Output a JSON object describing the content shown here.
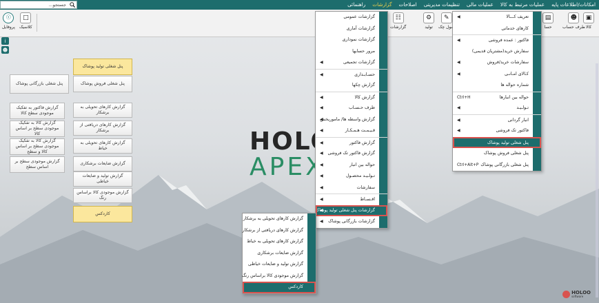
{
  "topbar": {
    "menu": [
      "امکانات/اطلاعات پایه",
      "عملیات مرتبط به کالا",
      "عملیات مالی",
      "تنظیمات مدیریتی",
      "اصلاحات",
      "گزارشات",
      "راهنمائی"
    ],
    "active_index": 5,
    "search_placeholder": "جستجو..."
  },
  "toolbar": {
    "left": [
      {
        "label": "پروفایل",
        "icon": "lamp-icon"
      },
      {
        "label": "کلاسیک",
        "icon": "classic-icon"
      }
    ],
    "right": [
      {
        "label": "کالا",
        "icon": "box-icon"
      },
      {
        "label": "طرف حساب",
        "icon": "account-icon"
      },
      {
        "label": "حسا",
        "icon": "ledger-icon"
      },
      {
        "label": "سول چک",
        "icon": "check-icon"
      },
      {
        "label": "تولید",
        "icon": "production-icon"
      },
      {
        "label": "گزارشات",
        "icon": "reports-icon"
      }
    ]
  },
  "panel": {
    "col_left": [
      "پنل شغلی بازرگانی پوشاک",
      "گزارش فاکتور به تفکیک موجودی سطح کالا",
      "گزارش کالا به تفکیک موجودی سطح بر اساس کالا",
      "گزارش کالا به تفکیک موجودی سطح بر اساس کالا و سطح",
      "گزارش موجودی سطح بر اساس سطح"
    ],
    "col_right": [
      "پنل شغلی تولید پوشاک",
      "پنل شغلی فروش پوشاک",
      "گزارش کارهای تحویلی به برشکار",
      "گزارش کارهای دریافتی از برشکار",
      "گزارش کارهای تحویلی به خیاط",
      "گزارش ضایعات برشکاری",
      "گزارش تولید و ضایعات خیاطی",
      "گزارش موجودی کالا براساس رنگ",
      "کاردکس"
    ]
  },
  "logo": {
    "line1": "HOLOO",
    "line2": "APEX"
  },
  "menu_kala": {
    "items": [
      {
        "label": "تعریف کـــالا",
        "arrow": true,
        "sep": false,
        "shortcut": ""
      },
      {
        "label": "کارهای خدماتی",
        "arrow": false,
        "sep": false,
        "shortcut": ""
      },
      {
        "label": "فاکتور : عمده فروشی",
        "arrow": true,
        "sep": true,
        "shortcut": ""
      },
      {
        "label": "سفارش خرید(مشتریان قدیمی)",
        "arrow": false,
        "sep": false,
        "shortcut": ""
      },
      {
        "label": "سفارشات خرید/فروش",
        "arrow": true,
        "sep": false,
        "shortcut": ""
      },
      {
        "label": "کـالای امـانـی",
        "arrow": true,
        "sep": false,
        "shortcut": ""
      },
      {
        "label": "شماره حواله ها",
        "arrow": false,
        "sep": false,
        "shortcut": ""
      },
      {
        "label": "حواله بین انبارها",
        "arrow": false,
        "sep": true,
        "shortcut": "Ctrl+H"
      },
      {
        "label": "تـولـیـد",
        "arrow": true,
        "sep": false,
        "shortcut": ""
      },
      {
        "label": "انبار گردانی",
        "arrow": true,
        "sep": true,
        "shortcut": ""
      },
      {
        "label": "فاکتور تک فروشی",
        "arrow": true,
        "sep": false,
        "shortcut": ""
      },
      {
        "label": "پنل شغلی تولید پوشاک",
        "arrow": false,
        "sep": true,
        "shortcut": "",
        "highlight": true
      },
      {
        "label": "پنل شغلی فروش پوشاک",
        "arrow": false,
        "sep": false,
        "shortcut": ""
      },
      {
        "label": "پنل شغلی بازرگانی پوشاک",
        "arrow": false,
        "sep": false,
        "shortcut": "Ctrl+Alt+P"
      }
    ]
  },
  "menu_reports": {
    "items": [
      {
        "label": "گزارشات عمومی",
        "arrow": false,
        "sep": false
      },
      {
        "label": "گزارشات آماری",
        "arrow": false,
        "sep": false
      },
      {
        "label": "گزارشات نموداری",
        "arrow": false,
        "sep": false
      },
      {
        "label": "مرور حسابها",
        "arrow": false,
        "sep": false
      },
      {
        "label": "گزارشات تجمیعی",
        "arrow": true,
        "sep": false
      },
      {
        "label": "حسـابـداری",
        "arrow": true,
        "sep": true
      },
      {
        "label": "گزارش چکها",
        "arrow": false,
        "sep": false
      },
      {
        "label": "گزارش کالا",
        "arrow": true,
        "sep": true
      },
      {
        "label": "طرف حـسـاب",
        "arrow": true,
        "sep": false
      },
      {
        "label": "گزارش واسطه ها/ ماموریخش",
        "arrow": true,
        "sep": false
      },
      {
        "label": "قـیـمـت هـمـکـار",
        "arrow": true,
        "sep": false
      },
      {
        "label": "گزارش فاکتور",
        "arrow": true,
        "sep": true
      },
      {
        "label": "گزارش فاکتور تک فروشی",
        "arrow": true,
        "sep": false
      },
      {
        "label": "حواله بین انبار",
        "arrow": true,
        "sep": false
      },
      {
        "label": "تـولـیـد محصـول",
        "arrow": true,
        "sep": false
      },
      {
        "label": "سفارشات",
        "arrow": true,
        "sep": false
      },
      {
        "label": "اقـسـاط",
        "arrow": true,
        "sep": true
      },
      {
        "label": "گزارشات پنل شغلی تولید پوشاک",
        "arrow": true,
        "sep": false,
        "highlight": true
      },
      {
        "label": "گزارشات بازرگانی پوشاک",
        "arrow": true,
        "sep": false
      }
    ]
  },
  "menu_sub": {
    "items": [
      {
        "label": "گزارش کارهای تحویلی به برشکار",
        "highlight": false
      },
      {
        "label": "گزارش کارهای دریافتی از برشکار",
        "highlight": false
      },
      {
        "label": "گزارش کارهای تحویلی به خیاط",
        "highlight": false
      },
      {
        "label": "گزارش ضایعات برشکاری",
        "highlight": false
      },
      {
        "label": "گزارش تولید و ضایعات خیاطی",
        "highlight": false
      },
      {
        "label": "گزارش موجودی کالا براساس رنگ",
        "highlight": false
      },
      {
        "label": "کاردکس",
        "highlight": true
      }
    ]
  },
  "brand_badge": "HOLOO",
  "brand_badge_sub": "software",
  "colors": {
    "accent": "#1d6d6d",
    "highlight_border": "#d9534f",
    "yellow_button": "#fbe79d"
  }
}
